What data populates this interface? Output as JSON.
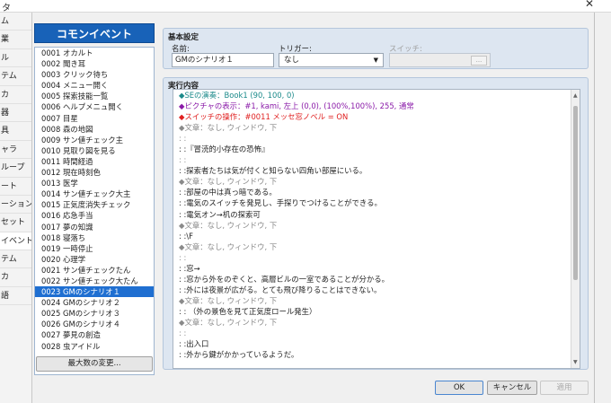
{
  "window": {
    "title_fragment": "タ",
    "close_glyph": "✕"
  },
  "left_tabs": [
    "ム",
    "業",
    "ル",
    "テム",
    "カ",
    "器",
    "具",
    "ャラ",
    "ループ",
    "ート",
    "ーション",
    "セット",
    "イベント",
    "テム",
    "カ",
    "語"
  ],
  "left_tab_selected": 12,
  "common_event": {
    "header": "コモンイベント",
    "items": [
      "0001 オカルト",
      "0002 聞き耳",
      "0003 クリック待ち",
      "0004 メニュー開く",
      "0005 探索技能一覧",
      "0006 ヘルプメニュ開く",
      "0007 目星",
      "0008 森の地図",
      "0009 サン値チェック主",
      "0010 見取り図を見る",
      "0011 時間経過",
      "0012 現在時刻色",
      "0013 医学",
      "0014 サン値チェック大主",
      "0015 正気度消失チェック",
      "0016 応急手当",
      "0017 夢の知識",
      "0018 寝落ち",
      "0019 一時停止",
      "0020 心理学",
      "0021 サン値チェックたん",
      "0022 サン値チェック大たん",
      "0023 GMのシナリオ１",
      "0024 GMのシナリオ２",
      "0025 GMのシナリオ３",
      "0026 GMのシナリオ４",
      "0027 夢見の創造",
      "0028 虫アイドル"
    ],
    "selected_index": 22,
    "max_button": "最大数の変更..."
  },
  "settings": {
    "section": "基本設定",
    "name_label": "名前:",
    "name_value": "GMのシナリオ１",
    "trigger_label": "トリガー:",
    "trigger_value": "なし",
    "trigger_arrow": "▼",
    "switch_label": "スイッチ:",
    "switch_button": "..."
  },
  "exec": {
    "section": "実行内容",
    "lines": [
      {
        "text": "◆SEの演奏：Book1 (90, 100, 0)",
        "color": "#1b8a8a"
      },
      {
        "text": "◆ピクチャの表示：#1, kami, 左上 (0,0), (100%,100%), 255, 通常",
        "color": "#8a1aa8"
      },
      {
        "text": "◆スイッチの操作：#0011 メッセ窓ノベル = ON",
        "color": "#e02020"
      },
      {
        "text": "◆文章：なし, ウィンドウ, 下",
        "color": "#8a8a8a"
      },
      {
        "text": "  :          :",
        "color": "#8a8a8a"
      },
      {
        "text": "  :          :『冒涜的小存在の恐怖』",
        "color": "#222222"
      },
      {
        "text": "  :          :",
        "color": "#8a8a8a"
      },
      {
        "text": "  :          :探索者たちは気が付くと知らない四角い部屋にいる。",
        "color": "#222222"
      },
      {
        "text": "◆文章：なし, ウィンドウ, 下",
        "color": "#8a8a8a"
      },
      {
        "text": "  :          :部屋の中は真っ暗である。",
        "color": "#222222"
      },
      {
        "text": "  :          :電気のスイッチを発見し、手探りでつけることができる。",
        "color": "#222222"
      },
      {
        "text": "  :          :電気オン→机の探索可",
        "color": "#222222"
      },
      {
        "text": "◆文章：なし, ウィンドウ, 下",
        "color": "#8a8a8a"
      },
      {
        "text": "  :          :\\F",
        "color": "#222222"
      },
      {
        "text": "◆文章：なし, ウィンドウ, 下",
        "color": "#8a8a8a"
      },
      {
        "text": "  :          :",
        "color": "#8a8a8a"
      },
      {
        "text": "  :          :窓→",
        "color": "#222222"
      },
      {
        "text": "  :          :窓から外をのぞくと、高層ビルの一室であることが分かる。",
        "color": "#222222"
      },
      {
        "text": "  :          :外には夜景が広がる。とても飛び降りることはできない。",
        "color": "#222222"
      },
      {
        "text": "◆文章：なし, ウィンドウ, 下",
        "color": "#8a8a8a"
      },
      {
        "text": "  :          :    （外の景色を見て正気度ロール発生）",
        "color": "#222222"
      },
      {
        "text": "◆文章：なし, ウィンドウ, 下",
        "color": "#8a8a8a"
      },
      {
        "text": "  :          :",
        "color": "#8a8a8a"
      },
      {
        "text": "  :          :出入口",
        "color": "#222222"
      },
      {
        "text": "  :          :外から鍵がかかっているようだ。",
        "color": "#222222"
      }
    ]
  },
  "buttons": {
    "ok": "OK",
    "cancel": "キャンセル",
    "apply": "適用"
  }
}
